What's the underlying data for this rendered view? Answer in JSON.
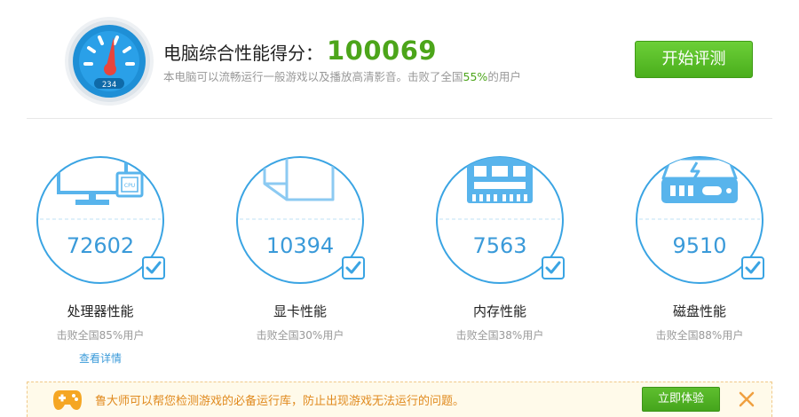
{
  "header": {
    "title_label": "电脑综合性能得分：",
    "score": "100069",
    "desc_prefix": "本电脑可以流畅运行一般游戏以及播放高清影音。击败了全国",
    "desc_percent": "55%",
    "desc_suffix": "的用户",
    "start_button": "开始评测",
    "gauge_digits": "234"
  },
  "cards": [
    {
      "value": "72602",
      "title": "处理器性能",
      "sub": "击败全国85%用户",
      "link": "查看详情",
      "icon_label": "CPU"
    },
    {
      "value": "10394",
      "title": "显卡性能",
      "sub": "击败全国30%用户"
    },
    {
      "value": "7563",
      "title": "内存性能",
      "sub": "击败全国38%用户"
    },
    {
      "value": "9510",
      "title": "磁盘性能",
      "sub": "击败全国88%用户"
    }
  ],
  "banner": {
    "text": "鲁大师可以帮您检测游戏的必备运行库，防止出现游戏无法运行的问题。",
    "button": "立即体验"
  },
  "colors": {
    "accent_blue": "#3a9ad9",
    "score_green": "#4ca51a",
    "banner_orange": "#e08a1e"
  },
  "icons": {
    "gauge": "speedometer-icon",
    "cpu": "monitor-cpu-icon",
    "gpu": "cube-icon",
    "memory": "ram-chip-icon",
    "disk": "hard-drive-icon",
    "check": "check-icon",
    "gamepad": "gamepad-icon",
    "close": "close-icon"
  }
}
